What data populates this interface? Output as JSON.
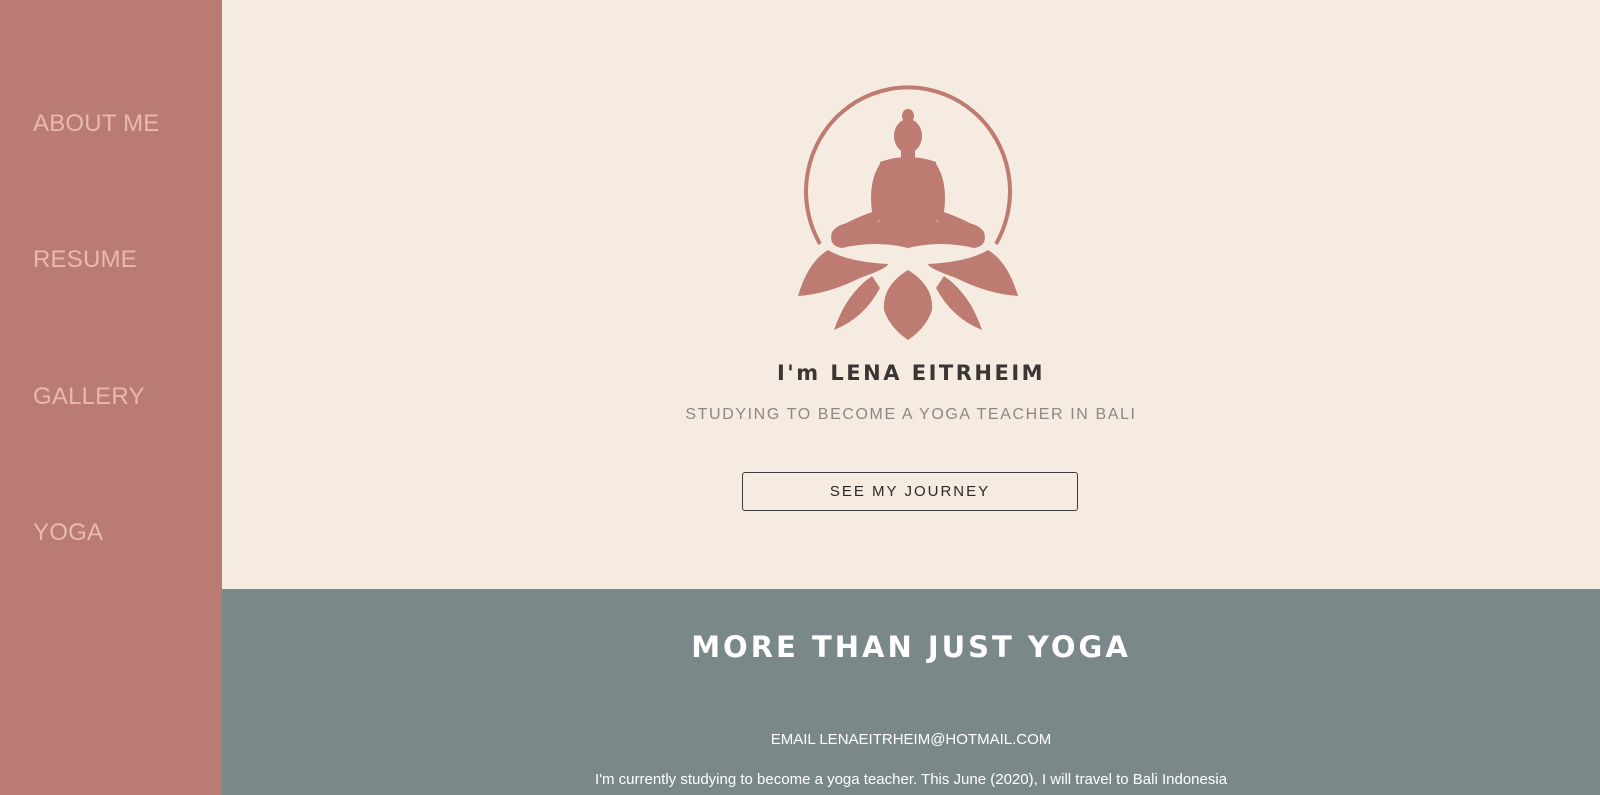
{
  "sidebar": {
    "items": [
      {
        "label": "ABOUT ME"
      },
      {
        "label": "RESUME"
      },
      {
        "label": "GALLERY"
      },
      {
        "label": "YOGA"
      }
    ]
  },
  "hero": {
    "logo_icon": "meditating-buddha-lotus-icon",
    "name": "I'm LENA EITRHEIM",
    "subtitle": "STUDYING TO BECOME A YOGA TEACHER IN BALI",
    "button_label": "SEE MY JOURNEY"
  },
  "about": {
    "title": "MORE THAN JUST YOGA",
    "email": "EMAIL LENAEITRHEIM@HOTMAIL.COM",
    "text": "I'm currently studying to become a yoga teacher. This June (2020), I will travel to Bali Indonesia"
  },
  "colors": {
    "sidebar": "#ba7c72",
    "background": "#f5ebe1",
    "band": "#7a8889",
    "accent": "#bd7b71"
  }
}
